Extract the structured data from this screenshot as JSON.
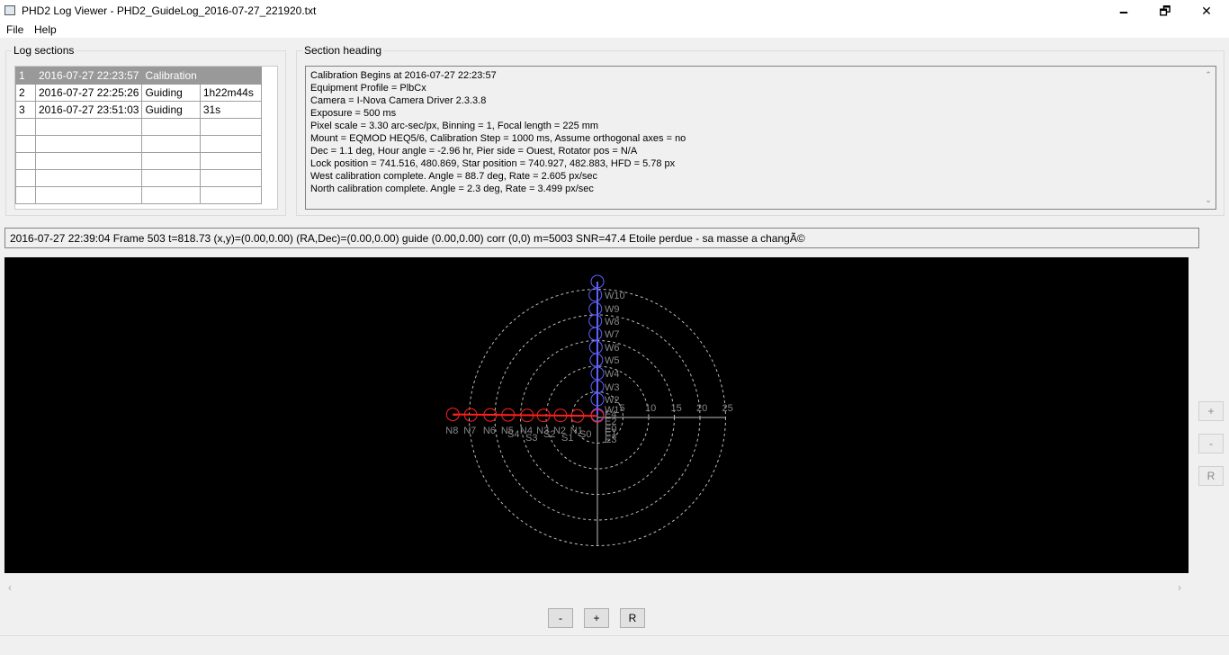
{
  "window": {
    "title": "PHD2 Log Viewer - PHD2_GuideLog_2016-07-27_221920.txt",
    "minimize": "🗕",
    "maximize": "🗗",
    "close": "✕"
  },
  "menu": [
    "File",
    "Help"
  ],
  "log_sections": {
    "label": "Log sections",
    "rows": [
      {
        "n": "1",
        "time": "2016-07-27 22:23:57",
        "type": "Calibration",
        "dur": ""
      },
      {
        "n": "2",
        "time": "2016-07-27 22:25:26",
        "type": "Guiding",
        "dur": "1h22m44s"
      },
      {
        "n": "3",
        "time": "2016-07-27 23:51:03",
        "type": "Guiding",
        "dur": "31s"
      }
    ],
    "empty_rows": 5
  },
  "section_heading": {
    "label": "Section heading",
    "lines": [
      "Calibration Begins at 2016-07-27 22:23:57",
      "Equipment Profile = PlbCx",
      "Camera = I-Nova Camera Driver 2.3.3.8",
      "Exposure = 500 ms",
      "Pixel scale = 3.30 arc-sec/px, Binning = 1, Focal length = 225 mm",
      "Mount = EQMOD HEQ5/6, Calibration Step = 1000 ms, Assume orthogonal axes = no",
      "Dec = 1.1 deg, Hour angle = -2.96 hr, Pier side = Ouest, Rotator pos = N/A",
      "Lock position = 741.516, 480.869, Star position = 740.927, 482.883, HFD = 5.78 px",
      "West calibration complete. Angle = 88.7 deg, Rate = 2.605 px/sec",
      "North calibration complete. Angle = 2.3 deg, Rate = 3.499 px/sec"
    ]
  },
  "status": "2016-07-27 22:39:04 Frame 503 t=818.73 (x,y)=(0.00,0.00) (RA,Dec)=(0.00,0.00) guide (0.00,0.00) corr (0,0) m=5003 SNR=47.4 Etoile perdue - sa masse a changÃ©",
  "chart_data": {
    "type": "scatter",
    "rings": [
      5,
      10,
      15,
      20,
      25
    ],
    "tick_labels": [
      "5",
      "10",
      "15",
      "20",
      "25"
    ],
    "colors": {
      "west": "#6060ff",
      "north": "#ff2020",
      "grid": "#bbbbbb",
      "label": "#888888"
    },
    "west": {
      "points": [
        [
          0,
          0.5
        ],
        [
          0,
          3.5
        ],
        [
          0,
          6
        ],
        [
          0,
          8.6
        ],
        [
          -0.2,
          11.2
        ],
        [
          -0.3,
          13.7
        ],
        [
          -0.4,
          16.3
        ],
        [
          -0.4,
          18.8
        ],
        [
          -0.4,
          21.2
        ],
        [
          -0.4,
          23.9
        ],
        [
          0,
          26.5
        ]
      ],
      "labels": [
        "W1",
        "W2",
        "W3",
        "W4",
        "W5",
        "W6",
        "W7",
        "W8",
        "W9",
        "W10"
      ]
    },
    "north": {
      "points": [
        [
          0,
          0.3
        ],
        [
          -3.9,
          0.3
        ],
        [
          -7.2,
          0.4
        ],
        [
          -10.5,
          0.4
        ],
        [
          -13.7,
          0.4
        ],
        [
          -17.4,
          0.5
        ],
        [
          -20.9,
          0.5
        ],
        [
          -24.7,
          0.5
        ],
        [
          -28.2,
          0.6
        ]
      ],
      "labels": [
        "N1",
        "N2",
        "N3",
        "N4",
        "N5",
        "N6",
        "N7",
        "N8"
      ]
    },
    "east_labels": [
      "E0",
      "E1",
      "E2",
      "E3",
      "E4"
    ],
    "south_labels": [
      "S0",
      "S1",
      "S2",
      "S3",
      "S4"
    ]
  },
  "plot_side_buttons": [
    "+",
    "-",
    "R"
  ],
  "bottom_buttons": [
    "-",
    "+",
    "R"
  ],
  "scroll": {
    "left": "‹",
    "right": "›"
  }
}
